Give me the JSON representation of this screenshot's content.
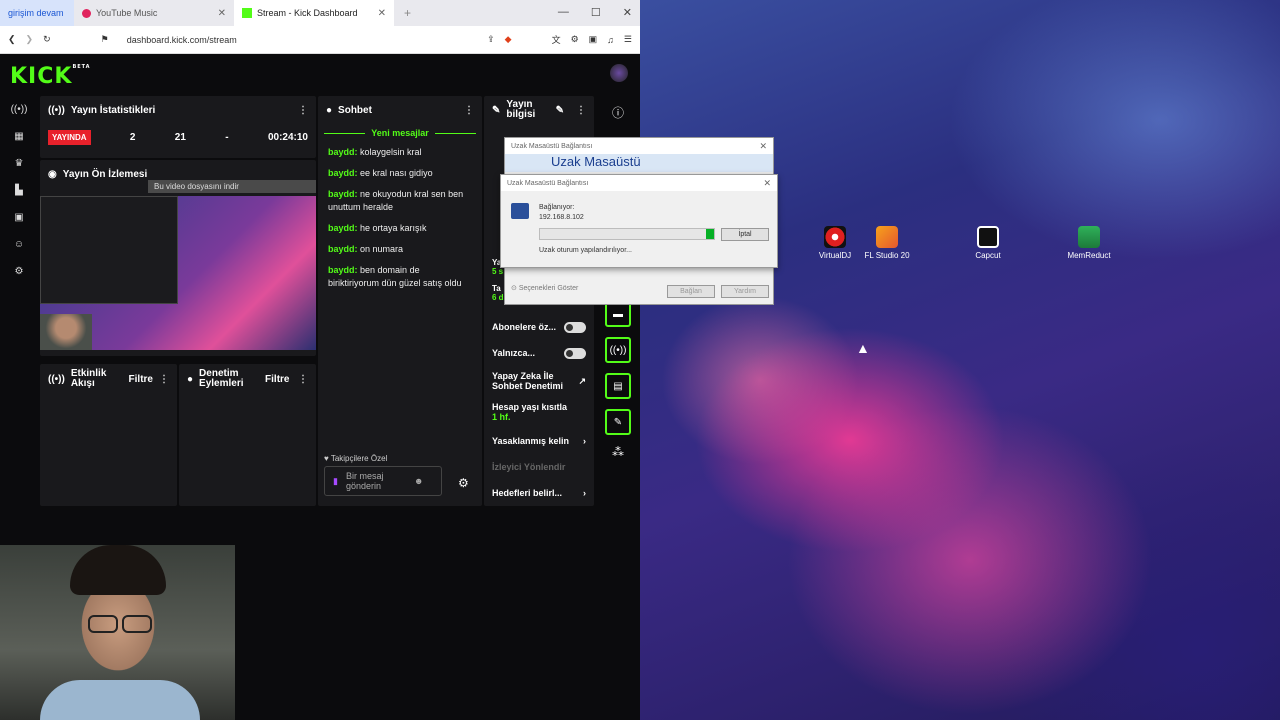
{
  "browser": {
    "tabs": [
      "girişim devam",
      "YouTube Music",
      "Stream - Kick Dashboard"
    ],
    "url": "dashboard.kick.com/stream"
  },
  "kick": {
    "logo": "KICK",
    "logo_sup": "BETA",
    "stats": {
      "title": "Yayın İstatistikleri",
      "live": "YAYINDA",
      "viewers": "2",
      "followers": "21",
      "subs": "-",
      "time": "00:24:10"
    },
    "preview": {
      "title": "Yayın Ön İzlemesi",
      "download": "Bu video dosyasını indir"
    },
    "activity": {
      "title": "Etkinlik Akışı",
      "filter": "Filtre"
    },
    "moderation": {
      "title": "Denetim Eylemleri",
      "filter": "Filtre"
    },
    "chat": {
      "title": "Sohbet",
      "new_messages": "Yeni mesajlar",
      "messages": [
        {
          "user": "baydd:",
          "text": "kolaygelsin kral"
        },
        {
          "user": "baydd:",
          "text": "ee kral nası gidiyo"
        },
        {
          "user": "baydd:",
          "text": "ne okuyodun kral sen ben unuttum heralde"
        },
        {
          "user": "baydd:",
          "text": "he ortaya karışık"
        },
        {
          "user": "baydd:",
          "text": "on numara"
        },
        {
          "user": "baydd:",
          "text": "ben domain de biriktiriyorum dün güzel satış oldu"
        }
      ],
      "followers_only": "Takipçilere Özel",
      "input_placeholder": "Bir mesaj gönderin"
    },
    "info": {
      "title": "Yayın bilgisi",
      "rows": [
        "Abonelere öz...",
        "Yalnızca...",
        "Yapay Zeka İle Sohbet Denetimi",
        "Hesap yaşı kısıtla",
        "Yasaklanmış kelin",
        "İzleyici Yönlendir",
        "Hedefleri belirl..."
      ],
      "account_age_value": "1 hf.",
      "yava_short": "Ya",
      "yava_value": "5 s",
      "ta_short": "Ta",
      "ta_value": "6 dk"
    }
  },
  "dialog": {
    "title": "Uzak Masaüstü Bağlantısı",
    "heading": "Uzak Masaüstü",
    "connecting": "Bağlanıyor:",
    "ip": "192.168.8.102",
    "status": "Uzak oturum yapılandırılıyor...",
    "cancel": "İptal",
    "options": "Seçenekleri Göster",
    "connect": "Bağlan",
    "help": "Yardım"
  },
  "desktop": {
    "icons": [
      "VirtualDJ",
      "FL Studio 20",
      "Capcut",
      "MemReduct"
    ]
  },
  "colors": {
    "kick_green": "#53fc18",
    "live_red": "#e8212b"
  }
}
